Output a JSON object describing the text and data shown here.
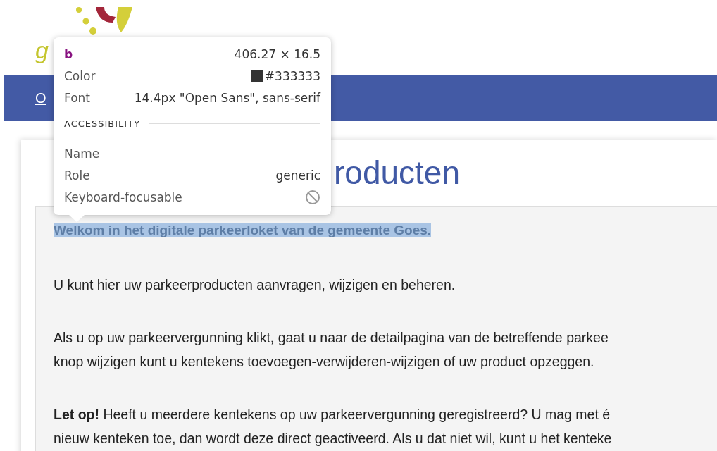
{
  "logo": {
    "text": "g"
  },
  "nav": {
    "links": [
      {
        "label": "O"
      }
    ]
  },
  "heading": {
    "visible_end": "roducten"
  },
  "intro": {
    "highlighted": true,
    "text": "Welkom in het digitale parkeerloket van de gemeente Goes."
  },
  "paragraphs": [
    {
      "lines": [
        "U kunt hier uw parkeerproducten aanvragen, wijzigen en beheren."
      ]
    },
    {
      "lines": [
        "Als u op uw parkeervergunning klikt, gaat u naar de detailpagina van de betreffende parkee",
        "knop wijzigen kunt u kentekens toevoegen-verwijderen-wijzigen of uw product opzeggen."
      ]
    },
    {
      "lines": [
        "**Let op!** Heeft u meerdere kentekens op uw parkeervergunning geregistreerd? U mag met é",
        "nieuw kenteken toe, dan wordt deze direct geactiveerd. Als u dat niet wil, kunt u het kenteke"
      ]
    }
  ],
  "inspector_tooltip": {
    "tag": "b",
    "size": "406.27 × 16.5",
    "rows": [
      {
        "label": "Color",
        "kind": "swatch",
        "value": "#333333"
      },
      {
        "label": "Font",
        "kind": "text",
        "value": "14.4px \"Open Sans\", sans-serif"
      }
    ],
    "section_title": "ACCESSIBILITY",
    "accessibility": [
      {
        "label": "Name",
        "kind": "text"
      },
      {
        "label": "Role",
        "kind": "text",
        "value": "generic"
      },
      {
        "label": "Keyboard-focusable",
        "kind": "flag",
        "focusable": false
      }
    ]
  }
}
